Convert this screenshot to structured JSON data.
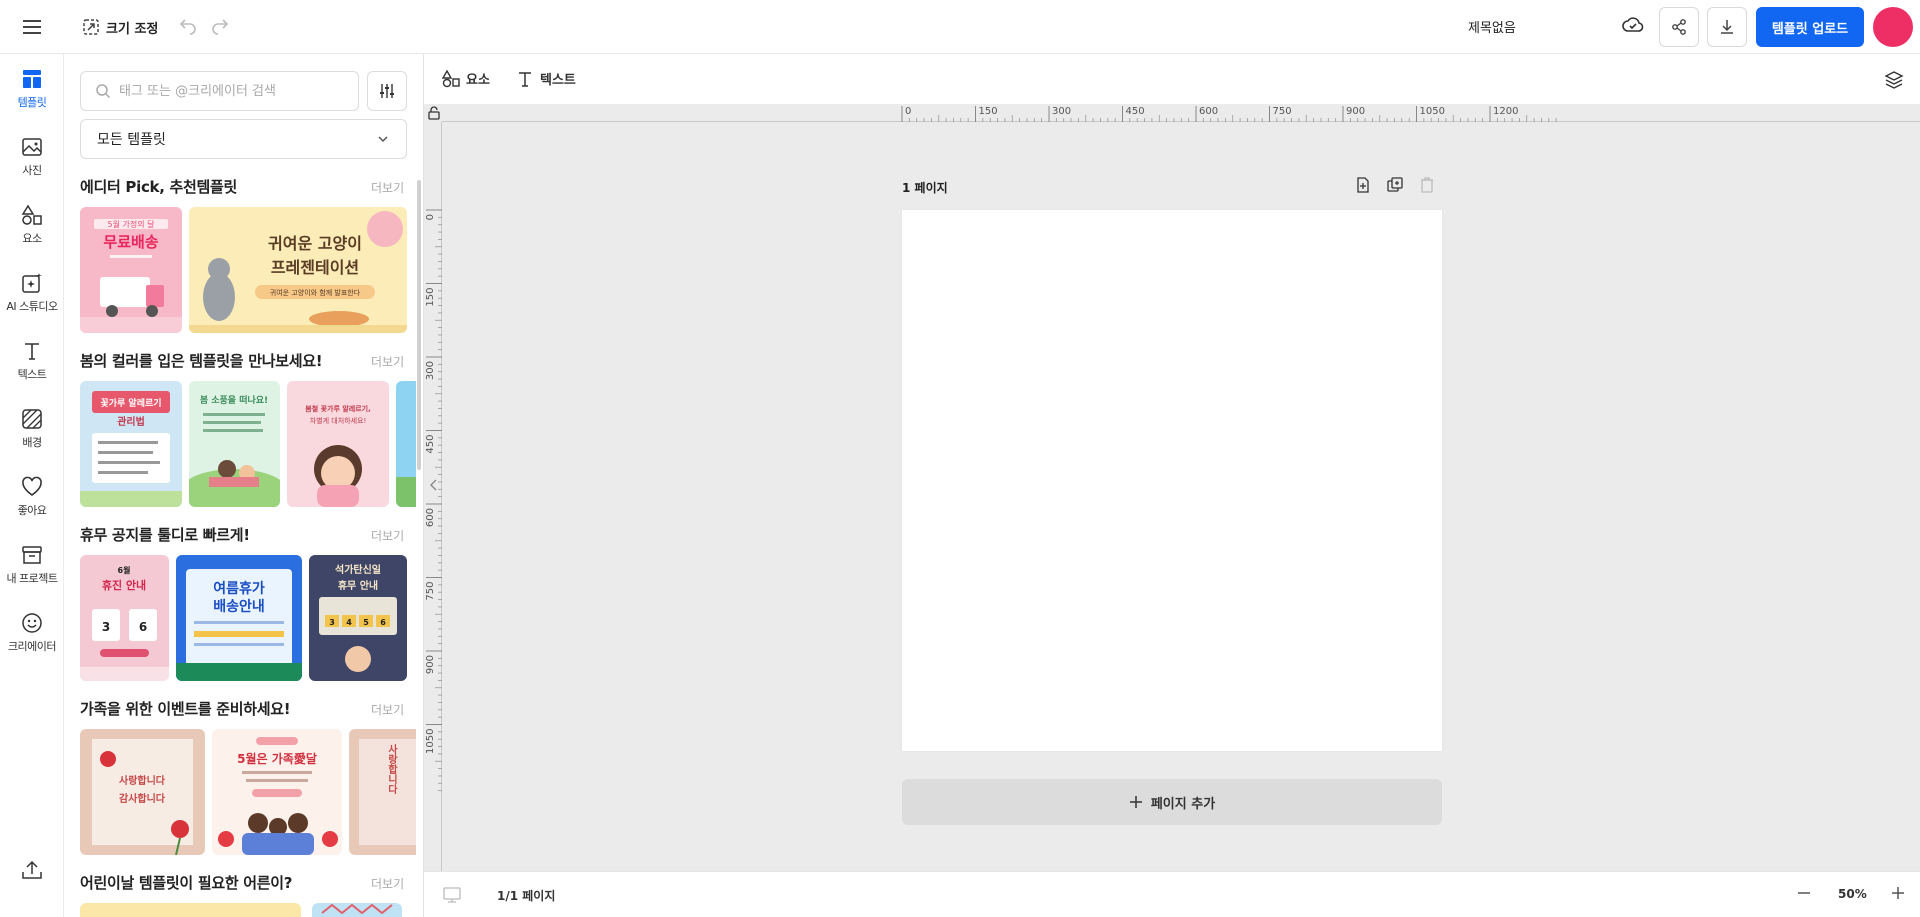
{
  "header": {
    "resize_label": "크기 조정",
    "doc_title": "제목없음",
    "upload_label": "템플릿 업로드"
  },
  "rail": {
    "items": [
      {
        "label": "템플릿",
        "icon": "template-icon",
        "active": true
      },
      {
        "label": "사진",
        "icon": "photo-icon"
      },
      {
        "label": "요소",
        "icon": "shapes-icon"
      },
      {
        "label": "AI 스튜디오",
        "icon": "ai-sparkle-icon"
      },
      {
        "label": "텍스트",
        "icon": "text-icon"
      },
      {
        "label": "배경",
        "icon": "background-icon"
      },
      {
        "label": "좋아요",
        "icon": "heart-icon"
      },
      {
        "label": "내 프로젝트",
        "icon": "archive-icon"
      },
      {
        "label": "크리에이터",
        "icon": "smile-icon"
      }
    ]
  },
  "panel": {
    "search_placeholder": "태그 또는 @크리에이터 검색",
    "select_value": "모든 템플릿",
    "more_label": "더보기",
    "sections": [
      {
        "title": "에디터 Pick, 추천템플릿",
        "thumbs": [
          {
            "line1": "5월 가정의 달",
            "line2": "무료배송",
            "bg": "#f7b8c8"
          },
          {
            "line1": "귀여운 고양이",
            "line2": "프레젠테이션",
            "line3": "귀여운 고양이와 함께 발표한다",
            "bg": "#fbecb8"
          }
        ]
      },
      {
        "title": "봄의 컬러를 입은 템플릿을 만나보세요!",
        "thumbs": [
          {
            "line1": "꽃가루 알레르기",
            "line2": "관리법",
            "bg": "#cfe7f5"
          },
          {
            "line1": "봄 소풍을 떠나요!",
            "bg": "#dff3e4"
          },
          {
            "line1": "봄철 꽃가루 알레르기,",
            "line2": "차별게 대처하세요!",
            "bg": "#f9d9dd"
          }
        ]
      },
      {
        "title": "휴무 공지를 툴디로 빠르게!",
        "thumbs": [
          {
            "line1": "6월",
            "line2": "휴진 안내",
            "d1": "3",
            "d2": "6",
            "bg": "#f5c9d4"
          },
          {
            "line1": "여름휴가",
            "line2": "배송안내",
            "bg": "#2a6ee0"
          },
          {
            "line1": "석가탄신일",
            "line2": "휴무 안내",
            "d1": "3",
            "d2": "4",
            "d3": "5",
            "d4": "6",
            "bg": "#3f4566"
          }
        ]
      },
      {
        "title": "가족을 위한 이벤트를 준비하세요!",
        "thumbs": [
          {
            "line1": "사랑합니다",
            "line2": "감사합니다",
            "bg": "#f6ece4"
          },
          {
            "line1": "5월은 가족愛달",
            "bg": "#fdf1ec"
          },
          {
            "line1": "사랑합니다",
            "bg": "#f4e3dc"
          }
        ]
      },
      {
        "title": "어린이날 템플릿이 필요한 어른이?",
        "thumbs": []
      }
    ]
  },
  "canvas": {
    "tool_elements": "요소",
    "tool_text": "텍스트",
    "page_label": "1 페이지",
    "add_page_label": "페이지 추가",
    "ruler_top": [
      "0",
      "150",
      "300",
      "450",
      "600",
      "750",
      "900",
      "1050",
      "1200"
    ],
    "ruler_left": [
      "0",
      "150",
      "300",
      "450",
      "600",
      "750",
      "900",
      "1050"
    ]
  },
  "status": {
    "page_count": "1/1 페이지",
    "zoom": "50%"
  }
}
